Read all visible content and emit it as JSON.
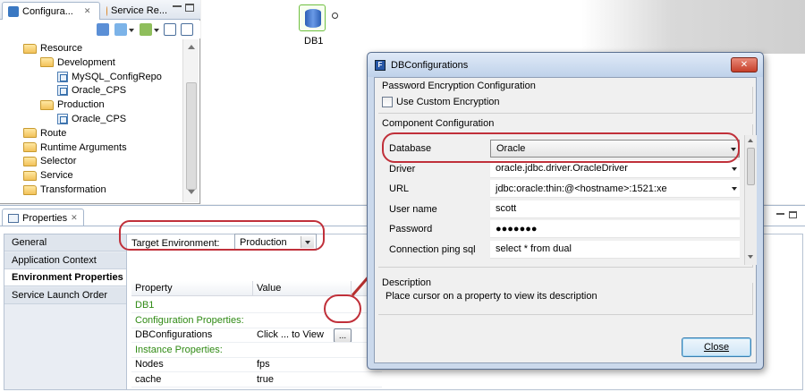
{
  "top_views": {
    "tabs": [
      {
        "label": "Configura...",
        "close": "✕"
      },
      {
        "label": "Service Re..."
      }
    ],
    "window_controls": [
      "minimize",
      "maximize"
    ]
  },
  "tree": {
    "items": [
      {
        "label": "Resource",
        "type": "folder",
        "indent": 0
      },
      {
        "label": "Development",
        "type": "folder",
        "indent": 1
      },
      {
        "label": "MySQL_ConfigRepo",
        "type": "node",
        "indent": 2
      },
      {
        "label": "Oracle_CPS",
        "type": "node",
        "indent": 2
      },
      {
        "label": "Production",
        "type": "folder",
        "indent": 1
      },
      {
        "label": "Oracle_CPS",
        "type": "node",
        "indent": 2
      },
      {
        "label": "Route",
        "type": "folder",
        "indent": 0
      },
      {
        "label": "Runtime Arguments",
        "type": "folder",
        "indent": 0
      },
      {
        "label": "Selector",
        "type": "folder",
        "indent": 0
      },
      {
        "label": "Service",
        "type": "folder",
        "indent": 0
      },
      {
        "label": "Transformation",
        "type": "folder",
        "indent": 0
      }
    ]
  },
  "canvas": {
    "db_label": "DB1"
  },
  "properties": {
    "tab_label": "Properties",
    "tab_close": "✕",
    "side_tabs": [
      "General",
      "Application Context",
      "Environment Properties",
      "Service Launch Order"
    ],
    "selected_tab_index": 2,
    "target_env_label": "Target Environment:",
    "target_env_value": "Production",
    "columns": [
      "Property",
      "Value"
    ],
    "rows": [
      {
        "property": "DB1",
        "value": "",
        "kind": "section"
      },
      {
        "property": "Configuration Properties:",
        "value": "",
        "kind": "section"
      },
      {
        "property": "DBConfigurations",
        "value": "Click ... to View",
        "kind": "row",
        "button": "..."
      },
      {
        "property": "Instance Properties:",
        "value": "",
        "kind": "section"
      },
      {
        "property": "Nodes",
        "value": "fps",
        "kind": "row"
      },
      {
        "property": "cache",
        "value": "true",
        "kind": "row"
      }
    ]
  },
  "dialog": {
    "icon_letter": "F",
    "title": "DBConfigurations",
    "close_glyph": "✕",
    "password_group": "Password Encryption Configuration",
    "use_custom_label": "Use Custom Encryption",
    "component_group": "Component Configuration",
    "fields": [
      {
        "label": "Database",
        "value": "Oracle"
      },
      {
        "label": "Driver",
        "value": "oracle.jdbc.driver.OracleDriver"
      },
      {
        "label": "URL",
        "value": "jdbc:oracle:thin:@<hostname>:1521:xe"
      },
      {
        "label": "User name",
        "value": "scott"
      },
      {
        "label": "Password",
        "value": "●●●●●●●"
      },
      {
        "label": "Connection ping sql",
        "value": "select * from dual"
      }
    ],
    "description_title": "Description",
    "description_text": "Place cursor on a property to view its description",
    "close_button": "Close"
  },
  "colors": {
    "highlight": "#c0303a",
    "section_text": "#2f8a14"
  }
}
